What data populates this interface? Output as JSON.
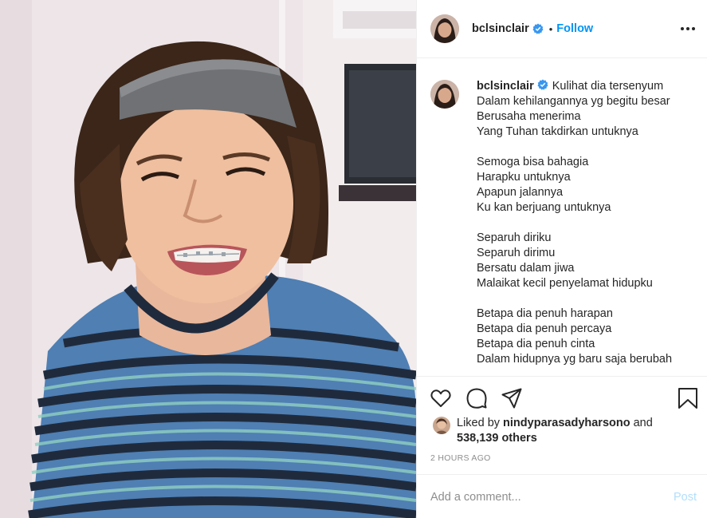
{
  "post": {
    "photo_icon": "photo-of-smiling-boy",
    "accent_color": "#0095f6"
  },
  "header": {
    "username": "bclsinclair",
    "separator": "•",
    "follow_label": "Follow",
    "verified_icon": "verified-badge-icon",
    "more_icon": "more-options-icon"
  },
  "caption": {
    "username": "bclsinclair",
    "stanzas": [
      [
        "Kulihat dia tersenyum",
        "Dalam kehilangannya yg begitu besar",
        "Berusaha menerima",
        "Yang Tuhan takdirkan untuknya"
      ],
      [
        "Semoga bisa bahagia",
        "Harapku untuknya",
        "Apapun jalannya",
        "Ku kan berjuang untuknya"
      ],
      [
        "Separuh diriku",
        "Separuh dirimu",
        "Bersatu dalam jiwa",
        "Malaikat kecil penyelamat hidupku"
      ],
      [
        "Betapa dia penuh harapan",
        "Betapa dia penuh percaya",
        "Betapa dia penuh cinta",
        "Dalam hidupnya yg baru saja berubah"
      ]
    ]
  },
  "actions": {
    "like_icon": "heart-icon",
    "comment_icon": "comment-icon",
    "share_icon": "share-icon",
    "save_icon": "bookmark-icon"
  },
  "likes": {
    "prefix": "Liked by ",
    "user": "nindyparasadyharsono",
    "middle": " and",
    "count": "538,139 others"
  },
  "timestamp": "2 HOURS AGO",
  "comment": {
    "placeholder": "Add a comment...",
    "post_label": "Post"
  }
}
